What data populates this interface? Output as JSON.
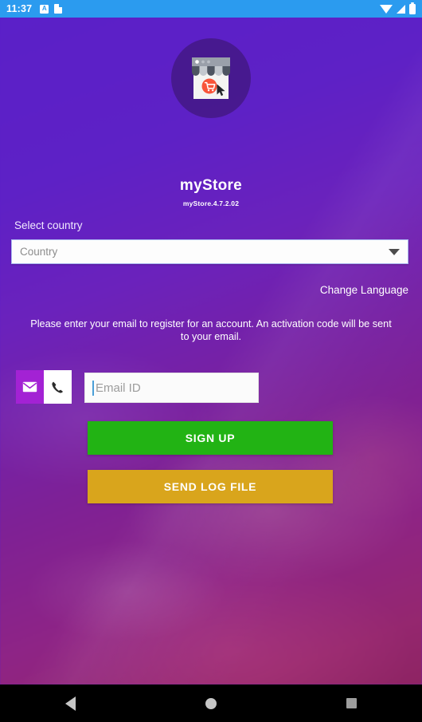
{
  "status_bar": {
    "time": "11:37",
    "left_icons": [
      {
        "name": "adb-icon",
        "glyph": "A"
      },
      {
        "name": "clipboard-icon",
        "glyph": ""
      }
    ],
    "right_icons": [
      {
        "name": "wifi-icon"
      },
      {
        "name": "cellular-signal-icon"
      },
      {
        "name": "battery-icon"
      }
    ],
    "background_color": "#2B9BEF"
  },
  "app": {
    "title": "myStore",
    "version": "myStore.4.7.2.02",
    "logo_alt": "storefront-logo",
    "background_gradient_from": "#5B20C8",
    "background_gradient_to": "#8E2463"
  },
  "country": {
    "label": "Select country",
    "placeholder": "Country",
    "selected_value": "",
    "caret_icon": "chevron-down-icon",
    "options": []
  },
  "language": {
    "change_label": "Change Language"
  },
  "instruction": {
    "text": "Please enter your email to register for an account. An activation code will be sent to your email."
  },
  "contact": {
    "mode_email_icon": "envelope-icon",
    "mode_phone_icon": "phone-icon",
    "active_mode": "email",
    "email_placeholder": "Email ID",
    "email_value": ""
  },
  "buttons": {
    "sign_up": "SIGN UP",
    "sign_up_color": "#22B314",
    "send_log_file": "SEND LOG FILE",
    "send_log_file_color": "#D9A51C"
  },
  "nav_bar": {
    "back": "back-button",
    "home": "home-button",
    "recents": "recents-button"
  }
}
